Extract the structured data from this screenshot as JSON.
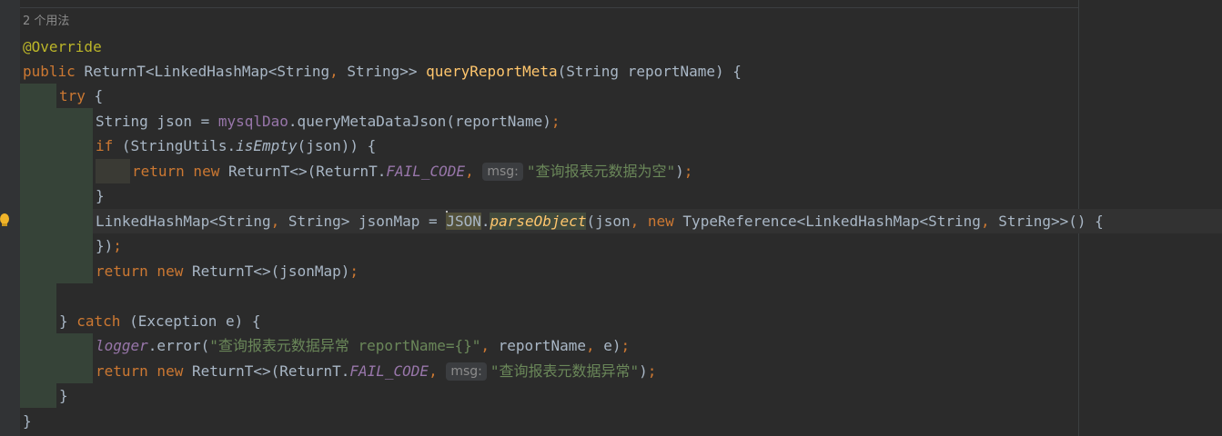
{
  "usage_hint": "2 个用法",
  "lines": [
    {
      "id": "l1",
      "tokens": [
        [
          "ann",
          "@Override"
        ]
      ]
    },
    {
      "id": "l2",
      "tokens": [
        [
          "kw",
          "public "
        ],
        [
          "t",
          "ReturnT<LinkedHashMap<String"
        ],
        [
          "kw",
          ", "
        ],
        [
          "t",
          "String>> "
        ],
        [
          "fn",
          "queryReportMeta"
        ],
        [
          "t",
          "(String reportName) {"
        ]
      ]
    },
    {
      "id": "l3",
      "tokens": [
        [
          "kw",
          "try "
        ],
        [
          "t",
          "{"
        ]
      ]
    },
    {
      "id": "l4",
      "tokens": [
        [
          "t",
          "String json = "
        ],
        [
          "field",
          "mysqlDao"
        ],
        [
          "t",
          ".queryMetaDataJson(reportName)"
        ],
        [
          "kw",
          ";"
        ]
      ]
    },
    {
      "id": "l5",
      "tokens": [
        [
          "kw",
          "if "
        ],
        [
          "t",
          "(StringUtils."
        ],
        [
          "ital",
          "isEmpty"
        ],
        [
          "t",
          "(json)) {"
        ]
      ]
    },
    {
      "id": "l6",
      "tokens": [
        [
          "kw",
          "return new "
        ],
        [
          "t",
          "ReturnT<>(ReturnT."
        ],
        [
          "fieldital",
          "FAIL_CODE"
        ],
        [
          "kw",
          ", "
        ],
        [
          "hint",
          "msg:"
        ],
        [
          "str",
          "\"查询报表元数据为空\""
        ],
        [
          "t",
          ")"
        ],
        [
          "kw",
          ";"
        ]
      ]
    },
    {
      "id": "l7",
      "tokens": [
        [
          "t",
          "}"
        ]
      ]
    },
    {
      "id": "l8",
      "tokens": [
        [
          "t",
          "LinkedHashMap<String"
        ],
        [
          "kw",
          ", "
        ],
        [
          "t",
          "String> jsonMap = "
        ],
        [
          "caret",
          ""
        ],
        [
          "hl",
          "JSON"
        ],
        [
          "t",
          "."
        ],
        [
          "fnitalhl",
          "parseObject"
        ],
        [
          "t",
          "(json"
        ],
        [
          "kw",
          ", new "
        ],
        [
          "t",
          "TypeReference<LinkedHashMap<String"
        ],
        [
          "kw",
          ", "
        ],
        [
          "t",
          "String>>() {"
        ]
      ]
    },
    {
      "id": "l9",
      "tokens": [
        [
          "t",
          "})"
        ],
        [
          "kw",
          ";"
        ]
      ]
    },
    {
      "id": "l10",
      "tokens": [
        [
          "kw",
          "return new "
        ],
        [
          "t",
          "ReturnT<>(jsonMap)"
        ],
        [
          "kw",
          ";"
        ]
      ]
    },
    {
      "id": "l11",
      "tokens": []
    },
    {
      "id": "l12",
      "tokens": [
        [
          "t",
          "} "
        ],
        [
          "kw",
          "catch "
        ],
        [
          "t",
          "(Exception e) {"
        ]
      ]
    },
    {
      "id": "l13",
      "tokens": [
        [
          "fieldital",
          "logger"
        ],
        [
          "t",
          ".error("
        ],
        [
          "str",
          "\"查询报表元数据异常 reportName={}\""
        ],
        [
          "kw",
          ", "
        ],
        [
          "t",
          "reportName"
        ],
        [
          "kw",
          ", "
        ],
        [
          "t",
          "e)"
        ],
        [
          "kw",
          ";"
        ]
      ]
    },
    {
      "id": "l14",
      "tokens": [
        [
          "kw",
          "return new "
        ],
        [
          "t",
          "ReturnT<>(ReturnT."
        ],
        [
          "fieldital",
          "FAIL_CODE"
        ],
        [
          "kw",
          ", "
        ],
        [
          "hint",
          "msg:"
        ],
        [
          "str",
          "\"查询报表元数据异常\""
        ],
        [
          "t",
          ")"
        ],
        [
          "kw",
          ";"
        ]
      ]
    },
    {
      "id": "l15",
      "tokens": [
        [
          "t",
          "}"
        ]
      ]
    },
    {
      "id": "l16",
      "tokens": [
        [
          "t",
          "}"
        ]
      ]
    }
  ],
  "icons": {
    "intention_bulb": "lightbulb-icon"
  },
  "colors": {
    "background": "#2b2b2b",
    "keyword": "#cc7832",
    "method": "#ffc66d",
    "string": "#6a8759",
    "field": "#9876aa",
    "annotation": "#bbb529",
    "text": "#a9b7c6"
  }
}
